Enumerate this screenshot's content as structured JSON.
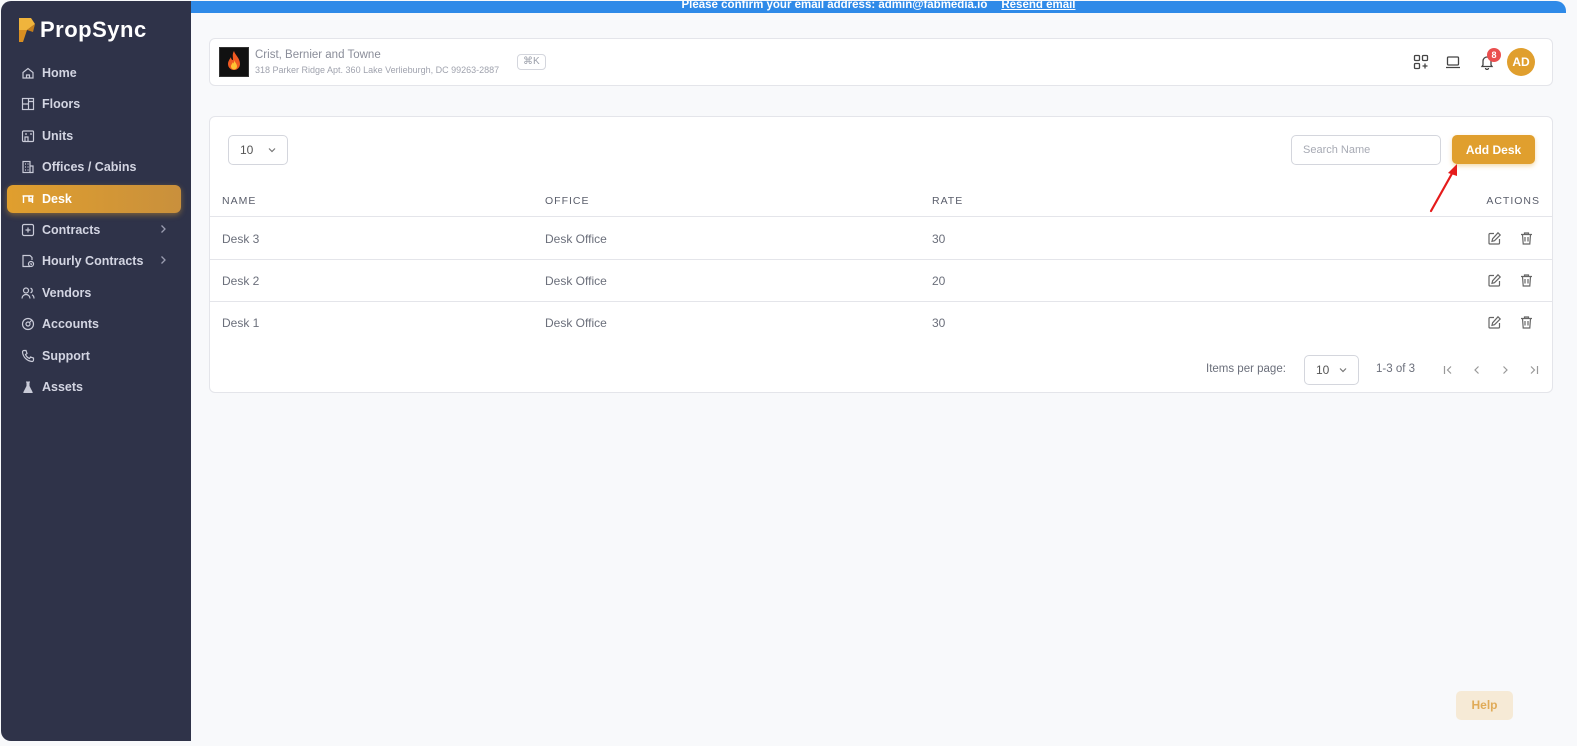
{
  "app": {
    "name": "PropSync"
  },
  "banner": {
    "message": "Please confirm your email address: admin@fabmedia.io",
    "link": "Resend email"
  },
  "sidebar": {
    "items": [
      {
        "label": "Home",
        "icon": "home-icon"
      },
      {
        "label": "Floors",
        "icon": "floors-icon"
      },
      {
        "label": "Units",
        "icon": "units-icon"
      },
      {
        "label": "Offices / Cabins",
        "icon": "office-building-icon"
      },
      {
        "label": "Desk",
        "icon": "desk-icon",
        "active": true
      },
      {
        "label": "Contracts",
        "icon": "contracts-icon",
        "has_submenu": true
      },
      {
        "label": "Hourly Contracts",
        "icon": "hourly-contracts-icon",
        "has_submenu": true
      },
      {
        "label": "Vendors",
        "icon": "vendors-icon"
      },
      {
        "label": "Accounts",
        "icon": "accounts-icon"
      },
      {
        "label": "Support",
        "icon": "phone-icon"
      },
      {
        "label": "Assets",
        "icon": "flask-icon"
      }
    ]
  },
  "header": {
    "org_name": "Crist, Bernier and Towne",
    "org_address": "318 Parker Ridge Apt. 360 Lake Verlieburgh, DC 99263-2887",
    "shortcut": "⌘K",
    "notification_count": "8",
    "avatar_initials": "AD"
  },
  "toolbar": {
    "page_size": "10",
    "search_placeholder": "Search Name",
    "add_label": "Add Desk"
  },
  "table": {
    "columns": [
      "NAME",
      "OFFICE",
      "RATE",
      "ACTIONS"
    ],
    "rows": [
      {
        "name": "Desk 3",
        "office": "Desk Office",
        "rate": "30"
      },
      {
        "name": "Desk 2",
        "office": "Desk Office",
        "rate": "20"
      },
      {
        "name": "Desk 1",
        "office": "Desk Office",
        "rate": "30"
      }
    ]
  },
  "pagination": {
    "items_per_page_label": "Items per page:",
    "page_size": "10",
    "range": "1-3 of 3"
  },
  "help": {
    "label": "Help"
  },
  "colors": {
    "sidebar_bg": "#2f3349",
    "accent": "#e09f2e",
    "banner": "#2f8ae8",
    "badge": "#ea4f4f"
  }
}
